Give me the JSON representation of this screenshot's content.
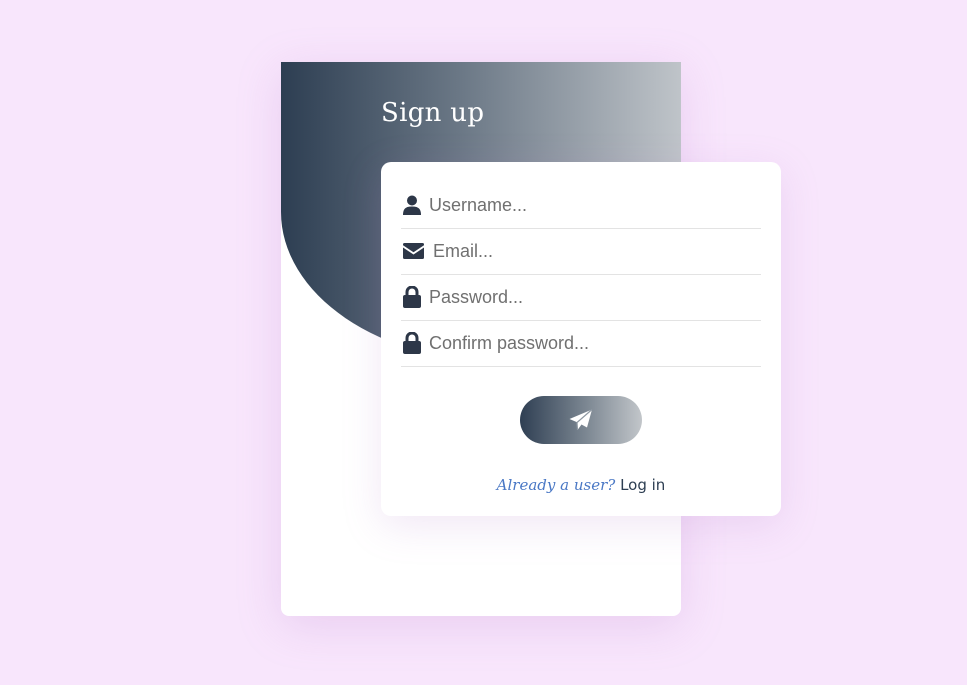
{
  "header": {
    "title": "Sign up"
  },
  "form": {
    "fields": [
      {
        "icon": "user-icon",
        "placeholder": "Username...",
        "value": ""
      },
      {
        "icon": "envelope-icon",
        "placeholder": "Email...",
        "value": ""
      },
      {
        "icon": "lock-icon",
        "placeholder": "Password...",
        "value": ""
      },
      {
        "icon": "lock-icon",
        "placeholder": "Confirm password...",
        "value": ""
      }
    ],
    "submit_icon": "paper-plane-icon"
  },
  "footer": {
    "question": "Already a user?",
    "login_link": "Log in"
  },
  "colors": {
    "background": "#f8e6fc",
    "gradient_dark": "#2d3e52",
    "gradient_light": "#bfc4c9",
    "link_blue": "#4a78c5",
    "icon_dark": "#2d3748"
  }
}
